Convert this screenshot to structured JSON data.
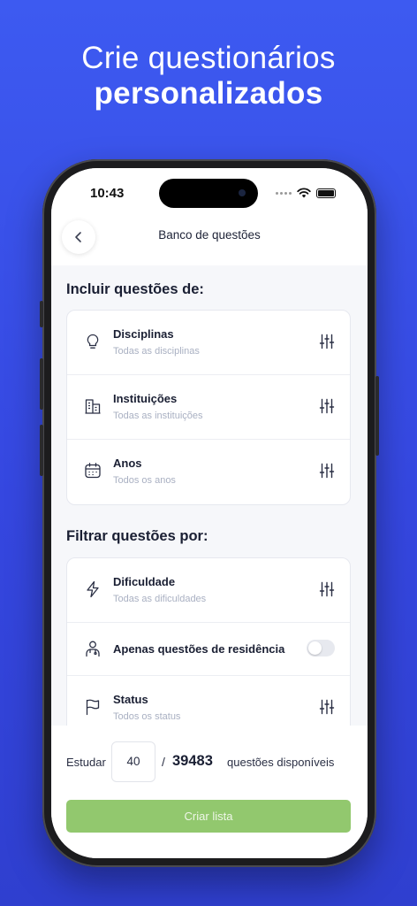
{
  "headline": {
    "line1": "Crie questionários",
    "line2": "personalizados"
  },
  "status_bar": {
    "time": "10:43"
  },
  "navbar": {
    "title": "Banco de questões",
    "back_icon": "chevron-left-icon"
  },
  "include_section": {
    "title": "Incluir questões de:",
    "items": [
      {
        "label": "Disciplinas",
        "value": "Todas as disciplinas",
        "icon": "lightbulb-icon"
      },
      {
        "label": "Instituições",
        "value": "Todas as instituições",
        "icon": "building-icon"
      },
      {
        "label": "Anos",
        "value": "Todos os anos",
        "icon": "calendar-icon"
      }
    ]
  },
  "filter_section": {
    "title": "Filtrar questões por:",
    "items": [
      {
        "label": "Dificuldade",
        "value": "Todas as dificuldades",
        "icon": "lightning-icon"
      },
      {
        "label": "Apenas questões de residência",
        "icon": "doctor-icon",
        "toggle_on": false
      },
      {
        "label": "Status",
        "value": "Todos os status",
        "icon": "flag-icon"
      }
    ]
  },
  "footer": {
    "study_label": "Estudar",
    "quantity": "40",
    "separator": "/",
    "total_available": "39483",
    "available_label": "questões disponíveis",
    "create_button": "Criar lista"
  },
  "colors": {
    "background": "#3d5af1",
    "primary_button": "#92c86e",
    "text_dark": "#1a1f33",
    "text_muted": "#a9b0c2"
  }
}
